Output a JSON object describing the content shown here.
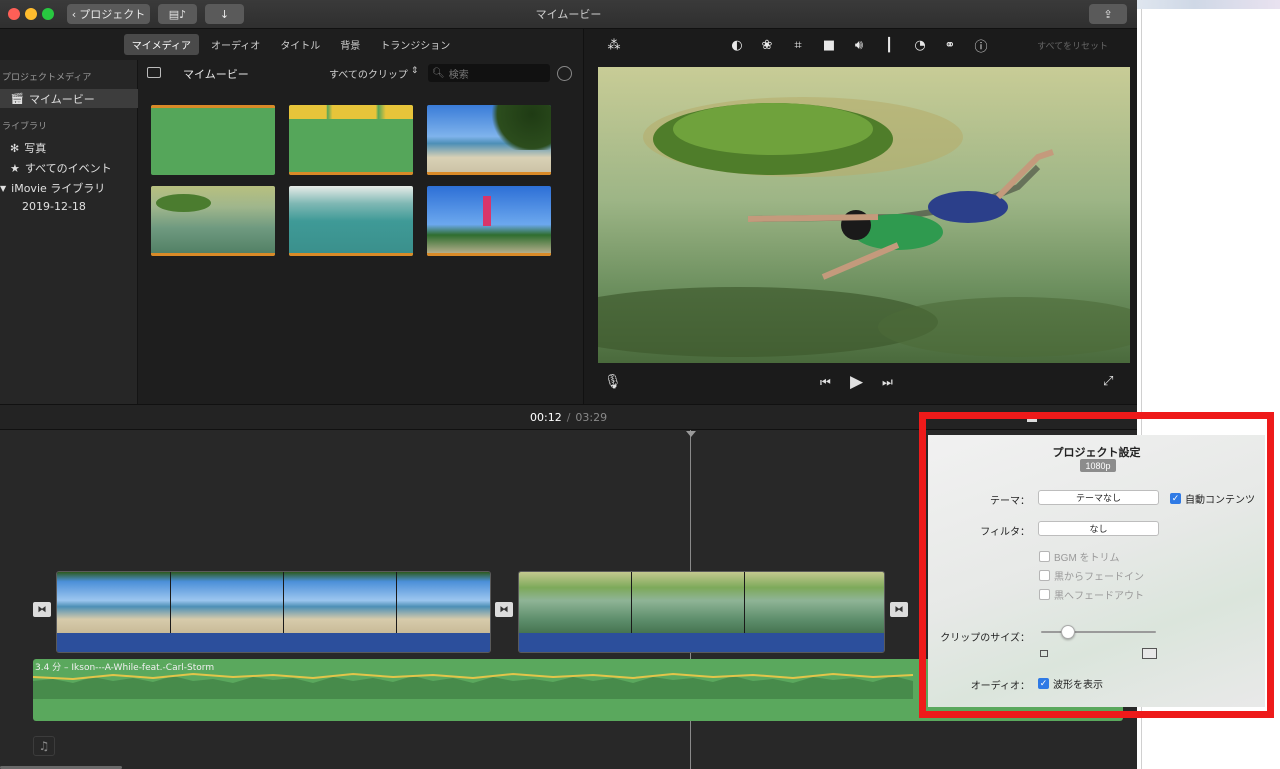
{
  "window": {
    "title": "マイムービー",
    "back_label": "プロジェクト"
  },
  "media": {
    "tabs": [
      "マイメディア",
      "オーディオ",
      "タイトル",
      "背景",
      "トランジション"
    ],
    "browser_title": "マイムービー",
    "filter_label": "すべてのクリップ",
    "search_placeholder": "検索"
  },
  "sidebar": {
    "project_header": "プロジェクトメディア",
    "project_item": "マイムービー",
    "library_header": "ライブラリ",
    "photos": "写真",
    "all_events": "すべてのイベント",
    "library_name": "iMovie ライブラリ",
    "event_date": "2019-12-18"
  },
  "viewer": {
    "reset_all": "すべてをリセット"
  },
  "timeline": {
    "current_time": "00:12",
    "separator": "/",
    "total_time": "03:29",
    "bgm_label": "3.4 分 – Ikson---A-While-feat.-Carl-Storm"
  },
  "project_settings": {
    "title": "プロジェクト設定",
    "resolution": "1080p",
    "theme_label": "テーマ：",
    "theme_value": "テーマなし",
    "auto_content_label": "自動コンテンツ",
    "auto_content_checked": true,
    "filter_label": "フィルタ：",
    "filter_value": "なし",
    "trim_bgm": "BGM をトリム",
    "fade_in": "黒からフェードイン",
    "fade_out": "黒へフェードアウト",
    "clip_size_label": "クリップのサイズ：",
    "clip_size_fraction": 0.2,
    "audio_label": "オーディオ：",
    "show_waveforms": "波形を表示",
    "show_waveforms_checked": true
  },
  "colors": {
    "highlight": "#ee1a1a",
    "audio_green": "#5aa85d",
    "clip_audio_blue": "#2c4f9c",
    "checkbox_blue": "#2f7ae5"
  }
}
